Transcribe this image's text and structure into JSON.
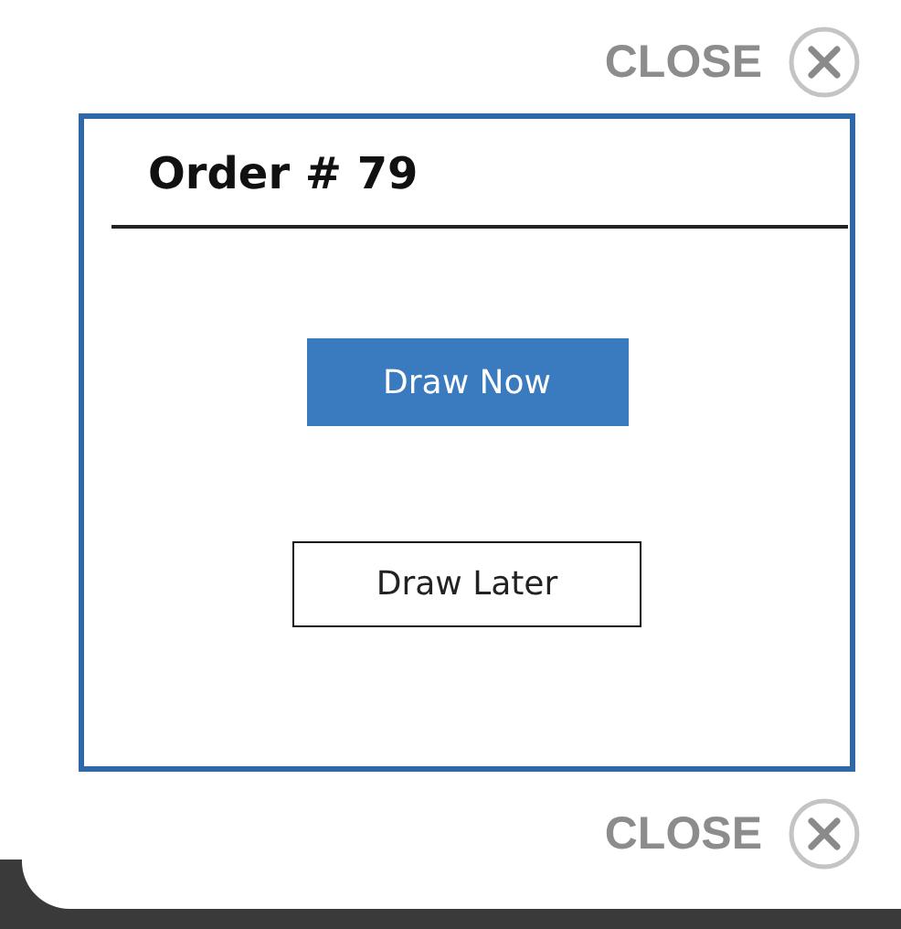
{
  "close_top": {
    "label": "CLOSE"
  },
  "dialog": {
    "title": "Order # 79",
    "buttons": [
      {
        "label": "Draw Now",
        "kind": "primary"
      },
      {
        "label": "Draw Later",
        "kind": "secondary"
      }
    ]
  },
  "close_bottom": {
    "label": "CLOSE"
  }
}
